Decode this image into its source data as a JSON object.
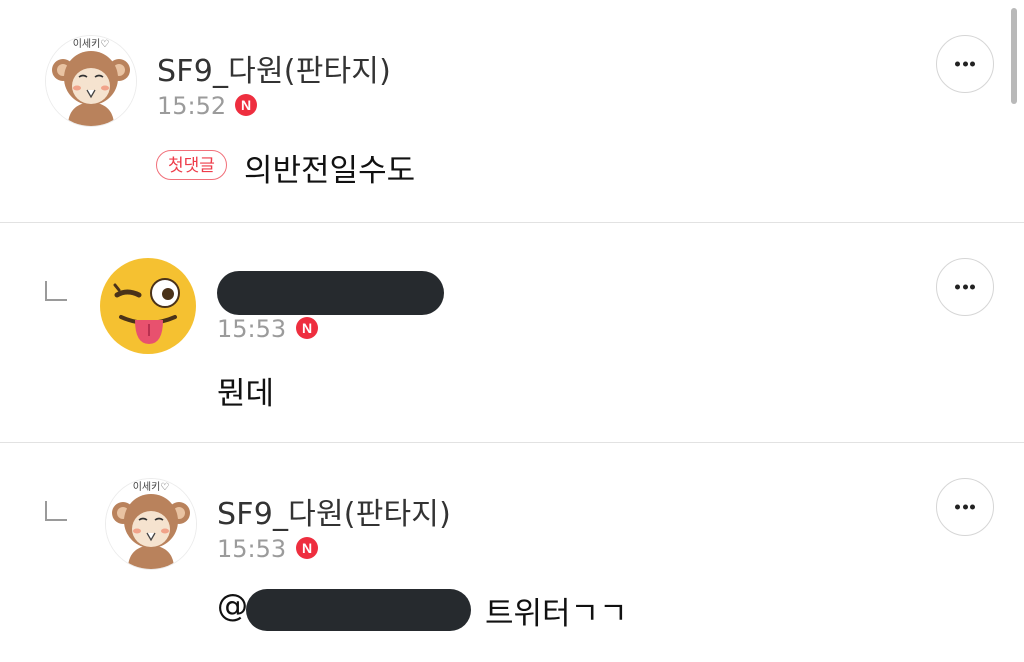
{
  "comments": [
    {
      "nickname": "SF9_다원(판타지)",
      "time": "15:52",
      "badge": "N",
      "first_comment_label": "첫댓글",
      "text": "의반전일수도",
      "avatar_icon": "monkey-avatar-icon",
      "avatar_label": "이세키♡",
      "more_icon": "more-options-icon"
    },
    {
      "nickname": "",
      "nickname_redacted": true,
      "time": "15:53",
      "badge": "N",
      "text": "뭔데",
      "avatar_icon": "winking-tongue-emoji-icon",
      "more_icon": "more-options-icon"
    },
    {
      "nickname": "SF9_다원(판타지)",
      "time": "15:53",
      "badge": "N",
      "mention_prefix": "@",
      "mention_redacted": true,
      "text_suffix": "트위터ㄱㄱ",
      "avatar_icon": "monkey-avatar-icon",
      "avatar_label": "이세키♡",
      "more_icon": "more-options-icon"
    }
  ],
  "colors": {
    "n_badge": "#ee2e3f",
    "first_badge_border": "#f1707a",
    "first_badge_text": "#ee3c4a",
    "divider": "#e2e2e2",
    "time": "#9b9b9b",
    "redaction": "#262a2e"
  }
}
